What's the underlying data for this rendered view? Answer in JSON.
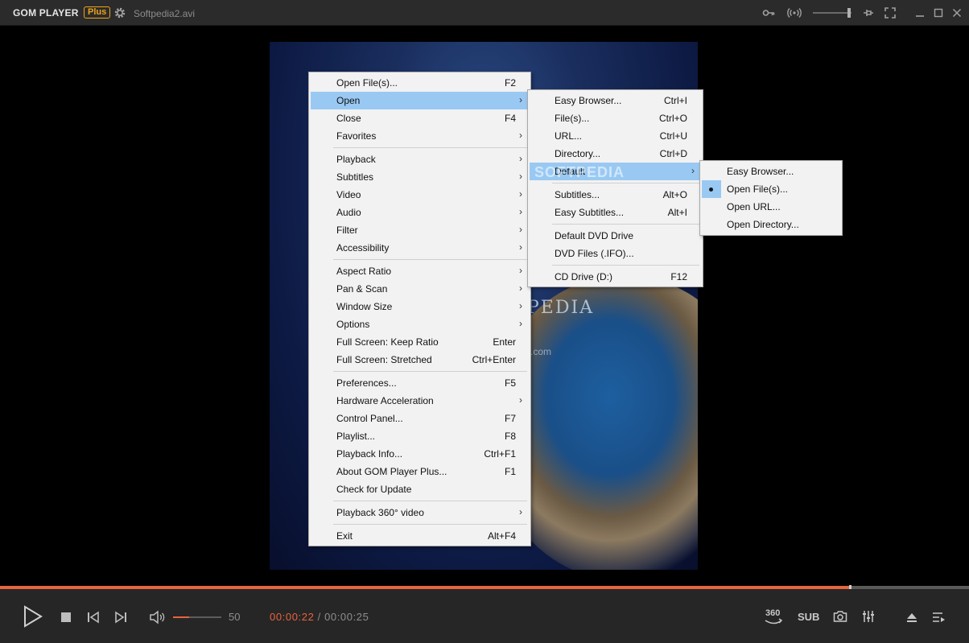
{
  "title_bar": {
    "brand": "GOM PLAYER",
    "plus_badge": "Plus",
    "filename": "Softpedia2.avi",
    "icons": [
      "settings-gear-icon",
      "key-icon",
      "broadcast-icon",
      "pin-icon",
      "fullscreen-icon",
      "minimize-icon",
      "maximize-icon",
      "close-icon"
    ]
  },
  "video": {
    "watermark_text": "PEDIA",
    "watermark_url": ".com"
  },
  "playback": {
    "progress_fraction": 0.876,
    "volume_value": "50",
    "volume_fraction": 0.33,
    "current_time": "00:00:22",
    "time_separator": "/",
    "total_time": "00:00:25",
    "sub_label": "SUB",
    "badge_360": "360",
    "icons": [
      "play-icon",
      "stop-icon",
      "previous-icon",
      "next-icon",
      "speaker-icon",
      "360-video-icon",
      "camera-icon",
      "equalizer-icon",
      "eject-icon",
      "playlist-icon"
    ]
  },
  "main_menu": {
    "items": [
      {
        "label": "Open File(s)...",
        "shortcut": "F2"
      },
      {
        "label": "Open",
        "submenu": true,
        "highlighted": true
      },
      {
        "label": "Close",
        "shortcut": "F4"
      },
      {
        "label": "Favorites",
        "submenu": true
      },
      {
        "separator": true
      },
      {
        "label": "Playback",
        "submenu": true
      },
      {
        "label": "Subtitles",
        "submenu": true
      },
      {
        "label": "Video",
        "submenu": true
      },
      {
        "label": "Audio",
        "submenu": true
      },
      {
        "label": "Filter",
        "submenu": true
      },
      {
        "label": "Accessibility",
        "submenu": true
      },
      {
        "separator": true
      },
      {
        "label": "Aspect Ratio",
        "submenu": true
      },
      {
        "label": "Pan & Scan",
        "submenu": true
      },
      {
        "label": "Window Size",
        "submenu": true
      },
      {
        "label": "Options",
        "submenu": true
      },
      {
        "label": "Full Screen: Keep Ratio",
        "shortcut": "Enter"
      },
      {
        "label": "Full Screen: Stretched",
        "shortcut": "Ctrl+Enter"
      },
      {
        "separator": true
      },
      {
        "label": "Preferences...",
        "shortcut": "F5"
      },
      {
        "label": "Hardware Acceleration",
        "submenu": true
      },
      {
        "label": "Control Panel...",
        "shortcut": "F7"
      },
      {
        "label": "Playlist...",
        "shortcut": "F8"
      },
      {
        "label": "Playback Info...",
        "shortcut": "Ctrl+F1"
      },
      {
        "label": "About GOM Player Plus...",
        "shortcut": "F1"
      },
      {
        "label": "Check for Update"
      },
      {
        "separator": true
      },
      {
        "label": "Playback 360° video",
        "submenu": true
      },
      {
        "separator": true
      },
      {
        "label": "Exit",
        "shortcut": "Alt+F4"
      }
    ]
  },
  "open_submenu": {
    "items": [
      {
        "label": "Easy Browser...",
        "shortcut": "Ctrl+I"
      },
      {
        "label": "File(s)...",
        "shortcut": "Ctrl+O"
      },
      {
        "label": "URL...",
        "shortcut": "Ctrl+U"
      },
      {
        "label": "Directory...",
        "shortcut": "Ctrl+D"
      },
      {
        "label": "Default",
        "submenu": true,
        "highlighted": true
      },
      {
        "separator": true
      },
      {
        "label": "Subtitles...",
        "shortcut": "Alt+O"
      },
      {
        "label": "Easy Subtitles...",
        "shortcut": "Alt+I"
      },
      {
        "separator": true
      },
      {
        "label": "Default DVD Drive"
      },
      {
        "label": "DVD Files (.IFO)..."
      },
      {
        "separator": true
      },
      {
        "label": "CD Drive (D:)",
        "shortcut": "F12"
      }
    ],
    "ghost_watermark": "SOFTPEDIA"
  },
  "default_submenu": {
    "items": [
      {
        "label": "Easy Browser..."
      },
      {
        "label": "Open File(s)...",
        "checked": true
      },
      {
        "label": "Open URL..."
      },
      {
        "label": "Open Directory..."
      }
    ]
  }
}
